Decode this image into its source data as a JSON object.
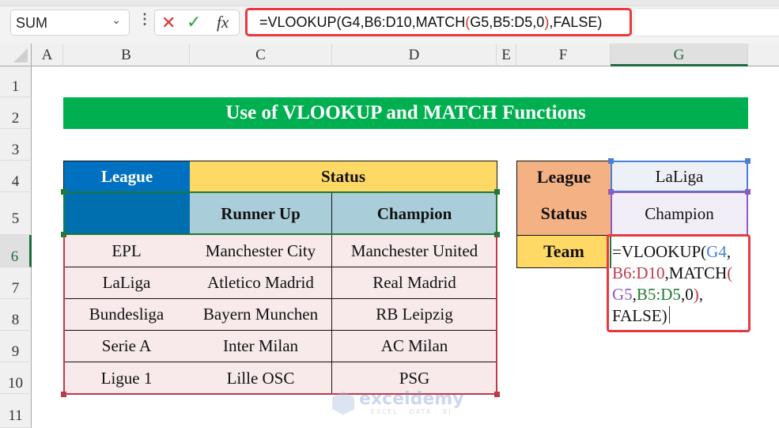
{
  "formula_bar": {
    "name_box": "SUM",
    "formula_prefix": "=VLOOKUP(G4,B6:D10,MATCH",
    "formula_paren_open": "(",
    "formula_middle": "G5,B5:D5,0",
    "formula_paren_close": ")",
    "formula_suffix": ",FALSE)",
    "cancel_icon": "✕",
    "enter_icon": "✓",
    "fx_label": "fx"
  },
  "columns": [
    "A",
    "B",
    "C",
    "D",
    "E",
    "F",
    "G"
  ],
  "rows": [
    "1",
    "2",
    "3",
    "4",
    "5",
    "6",
    "7",
    "8",
    "9",
    "10",
    "11"
  ],
  "selected_column": "G",
  "selected_row": "6",
  "sheet": {
    "title": "Use of VLOOKUP and MATCH Functions",
    "table": {
      "header_league": "League",
      "header_status": "Status",
      "sub_headers": [
        "Runner Up",
        "Champion"
      ],
      "rows": [
        {
          "league": "EPL",
          "runner_up": "Manchester City",
          "champion": "Manchester United"
        },
        {
          "league": "LaLiga",
          "runner_up": "Atletico Madrid",
          "champion": "Real Madrid"
        },
        {
          "league": "Bundesliga",
          "runner_up": "Bayern Munchen",
          "champion": "RB Leipzig"
        },
        {
          "league": "Serie A",
          "runner_up": "Inter Milan",
          "champion": "AC Milan"
        },
        {
          "league": "Ligue 1",
          "runner_up": "Lille OSC",
          "champion": "PSG"
        }
      ]
    },
    "lookup": {
      "league_label": "League",
      "league_value": "LaLiga",
      "status_label": "Status",
      "status_value": "Champion",
      "team_label": "Team",
      "formula_lines": {
        "l1a": "=VLOOKUP(",
        "l1b": "G4",
        "l1c": ",",
        "l2a": "B6:D10",
        "l2b": ",MATCH",
        "l2c": "(",
        "l3a": "G5",
        "l3b": ",",
        "l3c": "B5:D5",
        "l3d": ",0",
        "l3e": ")",
        "l3f": ",",
        "l4": "FALSE)"
      }
    }
  },
  "watermark": {
    "name": "exceldemy",
    "tagline": "EXCEL · DATA · BI"
  },
  "colors": {
    "title_bg": "#00b050",
    "league_header_bg": "#0070c0",
    "status_header_bg": "#ffd966",
    "subheader_bg": "#a9cdd9",
    "data_bg": "#f8e9ea",
    "lookup_label_bg": "#f4b183",
    "team_label_bg": "#ffd966",
    "highlight_red": "#e8393f"
  }
}
